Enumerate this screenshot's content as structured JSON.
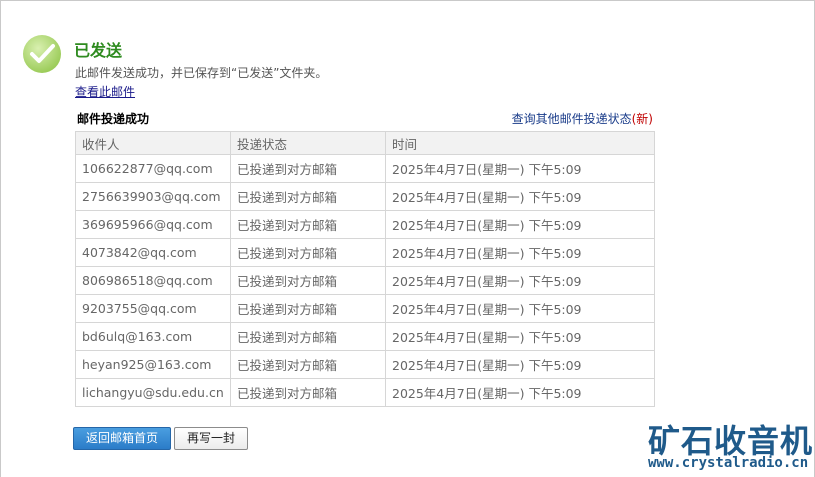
{
  "status": {
    "title": "已发送",
    "description": "此邮件发送成功，并已保存到“已发送”文件夹。",
    "view_link": "查看此邮件",
    "icon": "check-circle-icon",
    "accent_color": "#2e8b1f"
  },
  "delivery": {
    "section_title": "邮件投递成功",
    "query_link": "查询其他邮件投递状态",
    "query_new_badge": "(新)",
    "columns": [
      "收件人",
      "投递状态",
      "时间"
    ],
    "rows": [
      {
        "recipient": "106622877@qq.com",
        "status": "已投递到对方邮箱",
        "time": "2025年4月7日(星期一) 下午5:09"
      },
      {
        "recipient": "2756639903@qq.com",
        "status": "已投递到对方邮箱",
        "time": "2025年4月7日(星期一) 下午5:09"
      },
      {
        "recipient": "369695966@qq.com",
        "status": "已投递到对方邮箱",
        "time": "2025年4月7日(星期一) 下午5:09"
      },
      {
        "recipient": "4073842@qq.com",
        "status": "已投递到对方邮箱",
        "time": "2025年4月7日(星期一) 下午5:09"
      },
      {
        "recipient": "806986518@qq.com",
        "status": "已投递到对方邮箱",
        "time": "2025年4月7日(星期一) 下午5:09"
      },
      {
        "recipient": "9203755@qq.com",
        "status": "已投递到对方邮箱",
        "time": "2025年4月7日(星期一) 下午5:09"
      },
      {
        "recipient": "bd6ulq@163.com",
        "status": "已投递到对方邮箱",
        "time": "2025年4月7日(星期一) 下午5:09"
      },
      {
        "recipient": "heyan925@163.com",
        "status": "已投递到对方邮箱",
        "time": "2025年4月7日(星期一) 下午5:09"
      },
      {
        "recipient": "lichangyu@sdu.edu.cn",
        "status": "已投递到对方邮箱",
        "time": "2025年4月7日(星期一) 下午5:09"
      }
    ]
  },
  "actions": {
    "back_label": "返回邮箱首页",
    "compose_label": "再写一封"
  },
  "watermark": {
    "name": "矿石收音机",
    "url": "www.crystalradio.cn"
  }
}
